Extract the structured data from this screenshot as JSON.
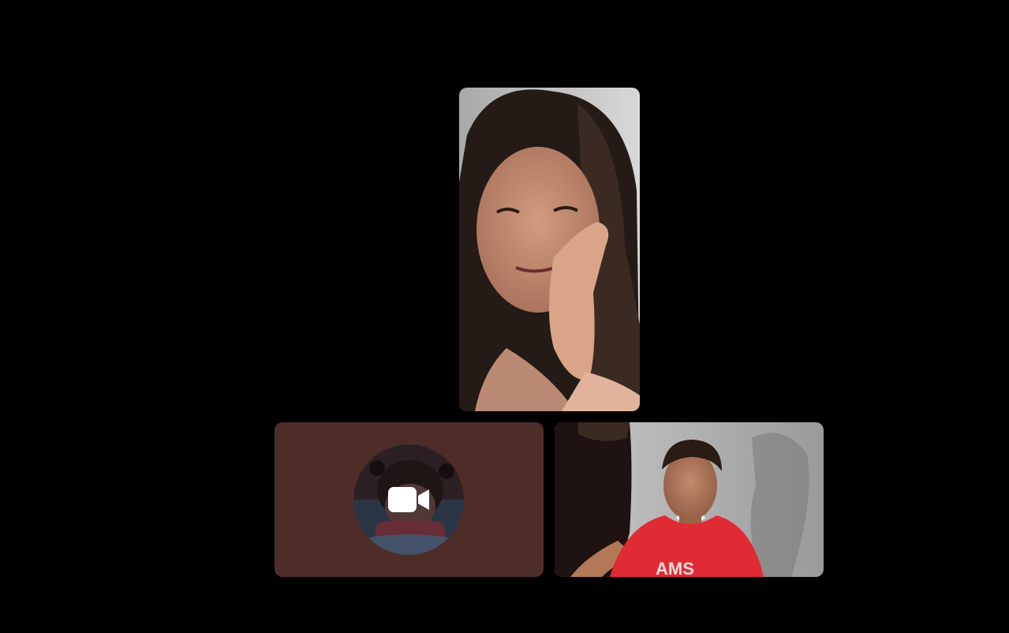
{
  "call": {
    "participants": [
      {
        "id": "participant-1",
        "video": "on",
        "feed_description_icon": "woman-face-video-feed"
      },
      {
        "id": "participant-2",
        "video": "off",
        "avatar_icon": "cartoon-girl-avatar",
        "status_icon": "camera-icon"
      },
      {
        "id": "participant-3",
        "video": "on",
        "feed_description_icon": "man-red-shirt-video-feed",
        "shirt_text": "AMS"
      }
    ]
  },
  "colors": {
    "background": "#000000",
    "camera_off_tile": "#4e2d29",
    "icon": "#ffffff"
  }
}
